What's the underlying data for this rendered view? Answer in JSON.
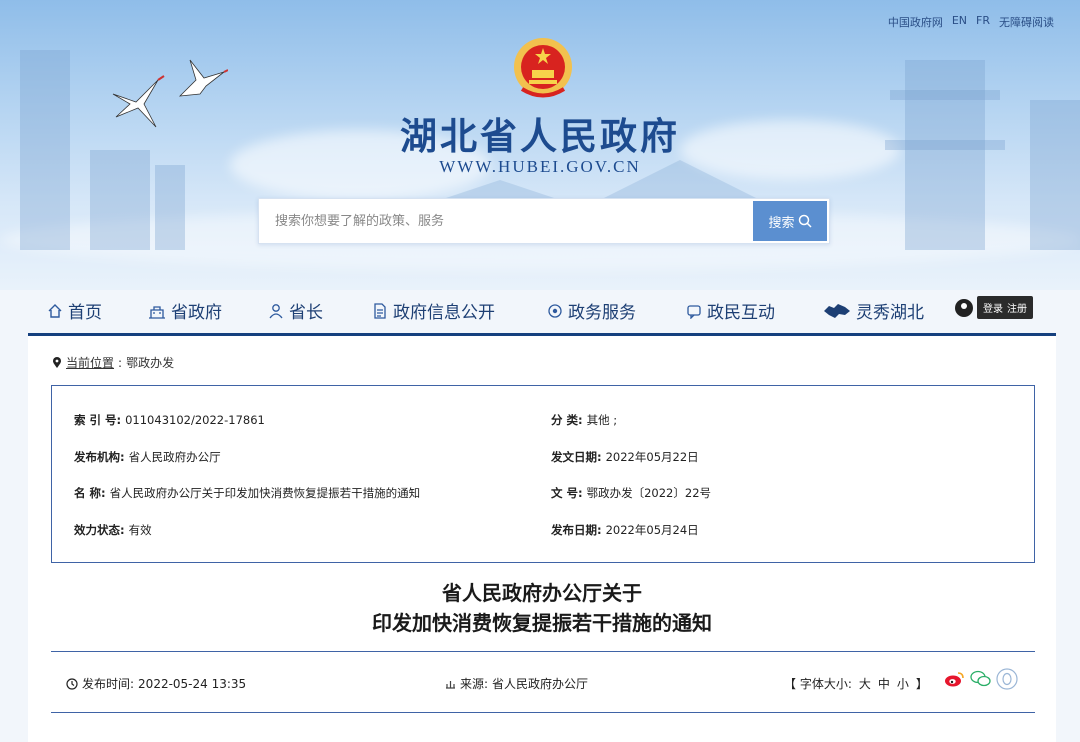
{
  "top_links": [
    "中国政府网",
    "EN",
    "FR",
    "无障碍阅读"
  ],
  "site": {
    "title": "湖北省人民政府",
    "url": "WWW.HUBEI.GOV.CN"
  },
  "search": {
    "placeholder": "搜索你想要了解的政策、服务",
    "button_label": "搜索"
  },
  "nav": [
    {
      "label": "首页",
      "icon": "home-icon"
    },
    {
      "label": "省政府",
      "icon": "building-icon"
    },
    {
      "label": "省长",
      "icon": "person-icon"
    },
    {
      "label": "政府信息公开",
      "icon": "document-icon"
    },
    {
      "label": "政务服务",
      "icon": "service-icon"
    },
    {
      "label": "政民互动",
      "icon": "chat-icon"
    },
    {
      "label": "灵秀湖北",
      "icon": "hubei-map-icon"
    }
  ],
  "login": {
    "login": "登录",
    "register": "注册"
  },
  "breadcrumb": {
    "prefix": "当前位置",
    "current": "鄂政办发"
  },
  "info": {
    "index_label": "索 引 号:",
    "index_value": "011043102/2022-17861",
    "category_label": "分 类:",
    "category_value": "其他 ;",
    "publisher_label": "发布机构:",
    "publisher_value": "省人民政府办公厅",
    "issue_date_label": "发文日期:",
    "issue_date_value": "2022年05月22日",
    "name_label": "名 称:",
    "name_value": "省人民政府办公厅关于印发加快消费恢复提振若干措施的通知",
    "doc_no_label": "文 号:",
    "doc_no_value": "鄂政办发〔2022〕22号",
    "status_label": "效力状态:",
    "status_value": "有效",
    "publish_date_label": "发布日期:",
    "publish_date_value": "2022年05月24日"
  },
  "doc_title": {
    "line1": "省人民政府办公厅关于",
    "line2": "印发加快消费恢复提振若干措施的通知"
  },
  "meta": {
    "time_label": "发布时间:",
    "time_value": "2022-05-24 13:35",
    "source_label": "来源:",
    "source_value": "省人民政府办公厅",
    "font_size_label": "【 字体大小:",
    "font_large": "大",
    "font_medium": "中",
    "font_small": "小",
    "font_close": "】"
  },
  "colors": {
    "brand": "#15407e",
    "accent": "#5b8fd0",
    "nav_text": "#1d3f74"
  }
}
